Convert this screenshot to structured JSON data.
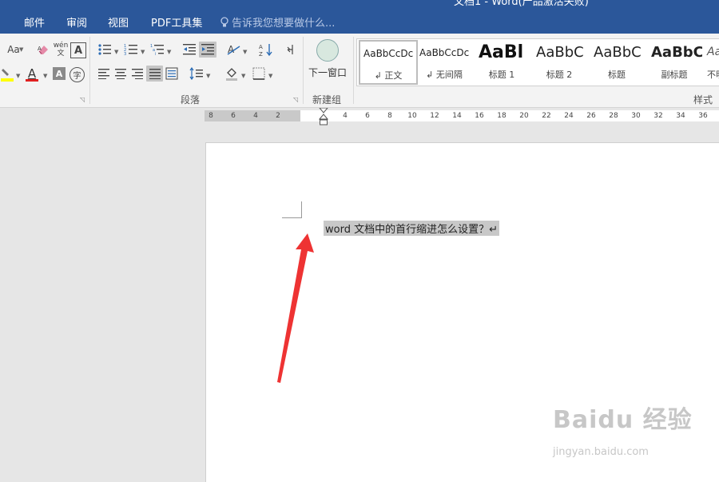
{
  "titlebar": {
    "title": "文档1 - Word(产品激活失败)"
  },
  "tabs": [
    "邮件",
    "审阅",
    "视图",
    "PDF工具集"
  ],
  "tell_me": {
    "placeholder": "告诉我您想要做什么..."
  },
  "ribbon": {
    "font_group": {
      "change_case_label": "Aa",
      "font_color_label": "A",
      "char_shading_label": "A",
      "phonetic_top": "wén",
      "phonetic_bottom": "文",
      "enclosed_char_label": "字",
      "border_char_label": "A"
    },
    "paragraph_group": {
      "label": "段落"
    },
    "new_group": {
      "button_label": "下一窗口",
      "label": "新建组"
    },
    "styles_group": {
      "label": "样式",
      "items": [
        {
          "preview": "AaBbCcDc",
          "name": "↲ 正文",
          "selected": true
        },
        {
          "preview": "AaBbCcDc",
          "name": "↲ 无间隔"
        },
        {
          "preview": "AaBl",
          "name": "标题 1"
        },
        {
          "preview": "AaBbC",
          "name": "标题 2"
        },
        {
          "preview": "AaBbC",
          "name": "标题"
        },
        {
          "preview": "AaBbC",
          "name": "副标题"
        },
        {
          "preview": "AaBbC",
          "name": "不明"
        }
      ]
    }
  },
  "ruler": {
    "left_ticks": [
      "8",
      "6",
      "4",
      "2"
    ],
    "right_ticks": [
      "2",
      "4",
      "6",
      "8",
      "10",
      "12",
      "14",
      "16",
      "18",
      "20",
      "22",
      "24",
      "26",
      "28",
      "30",
      "32",
      "34",
      "36"
    ]
  },
  "document": {
    "line": "word 文档中的首行缩进怎么设置？↵"
  },
  "watermark": {
    "main": "Baidu 经验",
    "sub": "jingyan.baidu.com"
  },
  "colors": {
    "tabbar": "#2b579a",
    "highlight": "#ffff00",
    "font_red": "#e02020",
    "arrow": "#ee3333"
  }
}
